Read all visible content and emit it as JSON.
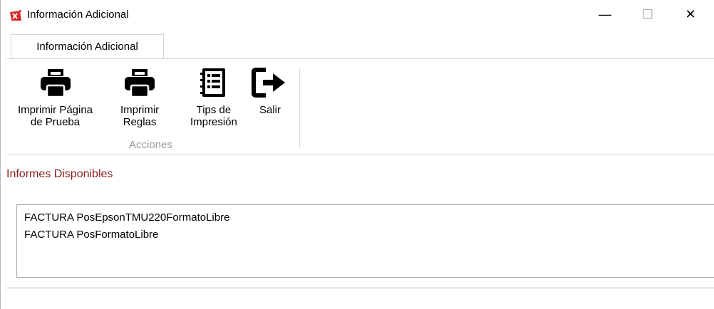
{
  "window": {
    "title": "Información Adicional",
    "minimize": "—",
    "maximize": "☐",
    "close": "✕"
  },
  "ribbon": {
    "tab_label": "Información Adicional",
    "buttons": [
      {
        "label_line1": "Imprimir Página",
        "label_line2": "de Prueba",
        "icon": "printer-icon"
      },
      {
        "label_line1": "Imprimir",
        "label_line2": "Reglas",
        "icon": "printer-icon"
      },
      {
        "label_line1": "Tips de",
        "label_line2": "Impresión",
        "icon": "notes-list-icon"
      },
      {
        "label_line1": "Salir",
        "label_line2": "",
        "icon": "exit-arrow-icon"
      }
    ],
    "group_label": "Acciones"
  },
  "main": {
    "section_title": "Informes Disponibles",
    "reports": [
      "FACTURA PosEpsonTMU220FormatoLibre",
      "FACTURA PosFormatoLibre"
    ]
  },
  "colors": {
    "section_title": "#8b1a1a",
    "group_label": "#9a9a9a"
  }
}
